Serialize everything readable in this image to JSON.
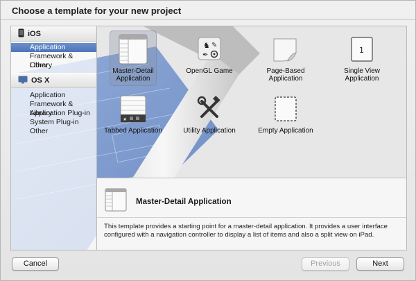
{
  "window": {
    "title": "Choose a template for your new project"
  },
  "sidebar": {
    "sections": [
      {
        "label": "iOS",
        "icon": "iphone-icon",
        "items": [
          "Application",
          "Framework & Library",
          "Other"
        ]
      },
      {
        "label": "OS X",
        "icon": "osx-icon",
        "items": [
          "Application",
          "Framework & Library",
          "Application Plug-in",
          "System Plug-in",
          "Other"
        ]
      }
    ],
    "selected": "iOS / Application"
  },
  "templates": [
    {
      "label_line1": "Master-Detail",
      "label_line2": "Application",
      "icon": "master-detail-icon",
      "selected": true
    },
    {
      "label_line1": "OpenGL Game",
      "label_line2": "",
      "icon": "opengl-game-icon"
    },
    {
      "label_line1": "Page-Based",
      "label_line2": "Application",
      "icon": "page-based-icon"
    },
    {
      "label_line1": "Single View",
      "label_line2": "Application",
      "icon": "single-view-icon",
      "page_number": "1"
    },
    {
      "label_line1": "Tabbed Application",
      "label_line2": "",
      "icon": "tabbed-app-icon"
    },
    {
      "label_line1": "Utility Application",
      "label_line2": "",
      "icon": "utility-app-icon"
    },
    {
      "label_line1": "Empty Application",
      "label_line2": "",
      "icon": "empty-app-icon"
    }
  ],
  "description": {
    "title": "Master-Detail Application",
    "text": "This template provides a starting point for a master-detail application. It provides a user interface configured with a navigation controller to display a list of items and also a split view on iPad."
  },
  "buttons": {
    "cancel": "Cancel",
    "previous": "Previous",
    "next": "Next"
  },
  "colors": {
    "selection": "#5a7fc0",
    "blueprint": "#6f90c9"
  }
}
